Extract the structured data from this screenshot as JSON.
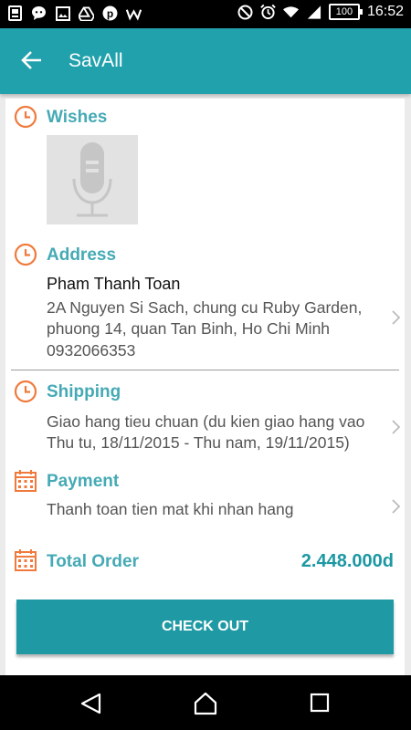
{
  "status_bar": {
    "time": "16:52",
    "battery": "100",
    "icons": [
      "sim-toolkit-icon",
      "chat-bubble-icon",
      "image-icon",
      "drive-icon",
      "pinterest-icon",
      "w-app-icon",
      "do-not-disturb-icon",
      "alarm-icon",
      "wifi-icon",
      "signal-icon"
    ]
  },
  "app_bar": {
    "title": "SavAll",
    "back_icon": "arrow-left-icon"
  },
  "sections": {
    "wishes": {
      "title": "Wishes",
      "icon": "clock-icon",
      "thumbnail_icon": "microphone-icon"
    },
    "address": {
      "title": "Address",
      "icon": "clock-icon",
      "name": "Pham Thanh Toan",
      "line1": "2A Nguyen Si Sach, chung cu Ruby Garden,",
      "line2": "phuong 14, quan Tan Binh, Ho Chi Minh",
      "phone": "0932066353"
    },
    "shipping": {
      "title": "Shipping",
      "icon": "clock-icon",
      "line1": "Giao hang tieu chuan (du kien giao hang vao",
      "line2": "Thu tu, 18/11/2015 - Thu nam, 19/11/2015)"
    },
    "payment": {
      "title": "Payment",
      "icon": "calendar-icon",
      "method": "Thanh toan tien mat khi nhan hang"
    },
    "total": {
      "label": "Total Order",
      "icon": "calendar-icon",
      "value": "2.448.000d"
    }
  },
  "checkout_label": "CHECK OUT",
  "colors": {
    "primary": "#21a1ac",
    "section_title": "#45aab5",
    "icon_orange": "#ef7a3c"
  }
}
